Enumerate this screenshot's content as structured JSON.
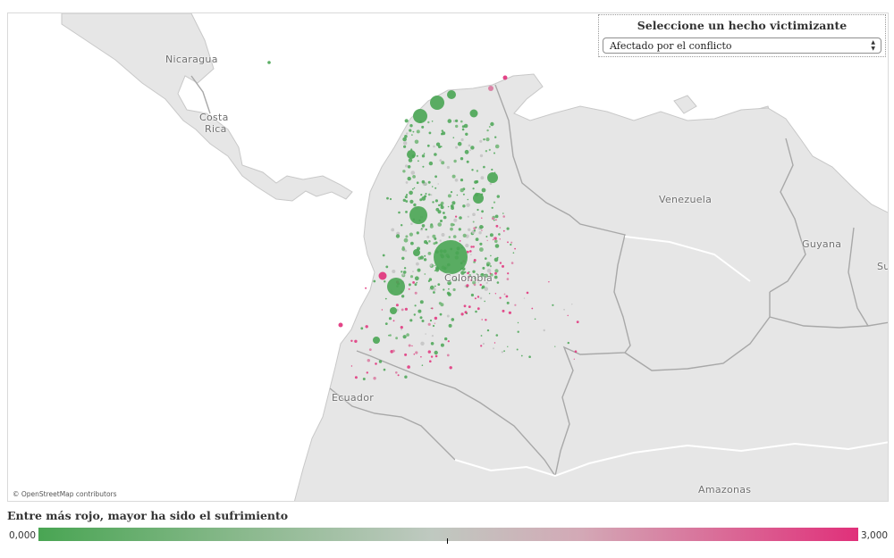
{
  "selector": {
    "title": "Seleccione un hecho victimizante",
    "value": "Afectado por el conflicto",
    "arrow_icon": "up-down-arrows"
  },
  "map": {
    "attribution": "© OpenStreetMap contributors",
    "labels": {
      "nicaragua": "Nicaragua",
      "costa": "Costa",
      "rica": "Rica",
      "venezuela": "Venezuela",
      "guyana": "Guyana",
      "su": "Su",
      "colombia": "Colombia",
      "ecuador": "Ecuador",
      "amazonas": "Amazonas"
    },
    "colors": {
      "low": "#49a553",
      "mid": "#c2c2c2",
      "high": "#e0307a",
      "land": "#e6e6e6",
      "sea": "#ffffff",
      "borders": "#a8a8a8"
    }
  },
  "legend": {
    "title": "Entre más rojo, mayor ha sido el sufrimiento",
    "min": "0,000",
    "max": "3,000"
  }
}
